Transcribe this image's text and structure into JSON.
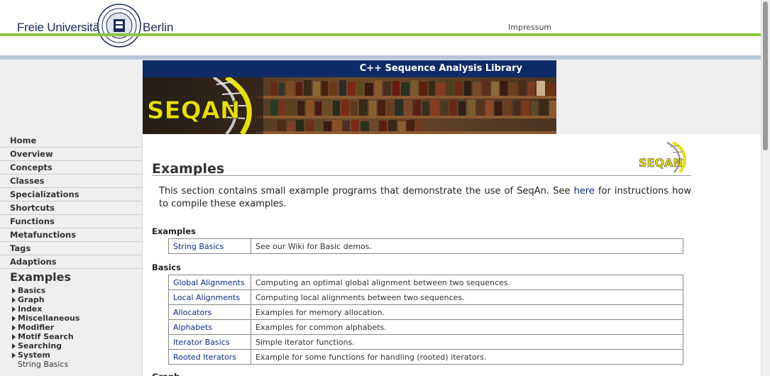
{
  "header": {
    "university_left": "Freie Universität",
    "university_right": "Berlin",
    "impressum": "Impressum"
  },
  "banner": {
    "title": "C++ Sequence Analysis Library",
    "logo_text": "SEQAN"
  },
  "sidebar": {
    "items": [
      {
        "label": "Home"
      },
      {
        "label": "Overview"
      },
      {
        "label": "Concepts"
      },
      {
        "label": "Classes"
      },
      {
        "label": "Specializations"
      },
      {
        "label": "Shortcuts"
      },
      {
        "label": "Functions"
      },
      {
        "label": "Metafunctions"
      },
      {
        "label": "Tags"
      },
      {
        "label": "Adaptions"
      }
    ],
    "current": "Examples",
    "subitems": [
      {
        "label": "Basics"
      },
      {
        "label": "Graph"
      },
      {
        "label": "Index"
      },
      {
        "label": "Miscellaneous"
      },
      {
        "label": "Modifier"
      },
      {
        "label": "Motif Search"
      },
      {
        "label": "Searching"
      },
      {
        "label": "System"
      }
    ],
    "leaf": "String Basics"
  },
  "main": {
    "title": "Examples",
    "intro_before": "This section contains small example programs that demonstrate the use of SeqAn. See ",
    "intro_link": "here",
    "intro_after": " for instructions how to compile these examples.",
    "sections": [
      {
        "heading": "Examples",
        "rows": [
          {
            "name": "String Basics",
            "desc": "See our Wiki for Basic demos."
          }
        ]
      },
      {
        "heading": "Basics",
        "rows": [
          {
            "name": "Global Alignments",
            "desc": "Computing an optimal global alignment between two sequences."
          },
          {
            "name": "Local Alignments",
            "desc": "Computing local alignments between two sequences."
          },
          {
            "name": "Allocators",
            "desc": "Examples for memory allocation."
          },
          {
            "name": "Alphabets",
            "desc": "Examples for common alphabets."
          },
          {
            "name": "Iterator Basics",
            "desc": "Simple iterator functions."
          },
          {
            "name": "Rooted Iterators",
            "desc": "Example for some functions for handling (rooted) iterators."
          }
        ]
      }
    ],
    "next_heading": "Graph"
  },
  "colors": {
    "green": "#8cc63f",
    "navy": "#0e2b66",
    "link": "#0e2b88",
    "seqan_yellow": "#e8e000"
  }
}
